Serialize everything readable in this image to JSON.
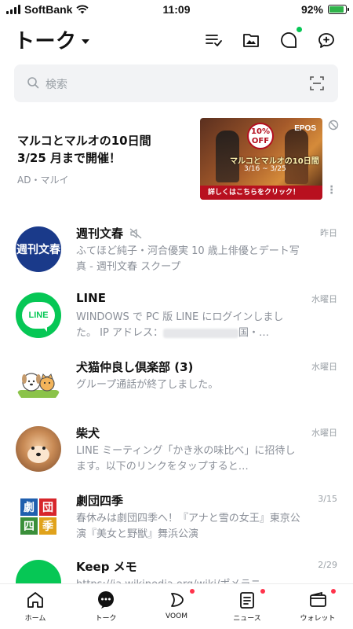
{
  "status_bar": {
    "carrier": "SoftBank",
    "time": "11:09",
    "battery": "92%",
    "battery_level": 0.92
  },
  "header": {
    "title": "トーク"
  },
  "search": {
    "placeholder": "検索"
  },
  "ad": {
    "text_line1": "マルコとマルオの10日間",
    "text_line2": "3/25 月まで開催！",
    "label": "AD・マルイ",
    "banner": {
      "badge": "10% OFF",
      "brand": "EPOS",
      "headline": "マルコとマルオの10日間",
      "date": "3/16 ~ 3/25",
      "cta": "詳しくはこちらをクリック！"
    }
  },
  "chats": [
    {
      "name": "週刊文春",
      "avatar_text": "週刊文春",
      "muted": true,
      "time": "昨日",
      "preview": "ふてほど純子・河合優実 10 歳上俳優とデート写真 - 週刊文春 スクープ"
    },
    {
      "name": "LINE",
      "avatar_text": "LINE",
      "time": "水曜日",
      "preview_line1": "WINDOWS で PC 版 LINE にログインしました。 IP アドレス：",
      "preview_line2": "国・…"
    },
    {
      "name": "犬猫仲良し倶楽部 (3)",
      "time": "水曜日",
      "preview": "グループ通話が終了しました。"
    },
    {
      "name": "柴犬",
      "time": "水曜日",
      "preview": "LINE ミーティング「かき氷の味比べ」に招待します。以下のリンクをタップすると…"
    },
    {
      "name": "劇団四季",
      "avatar_chars": [
        "劇",
        "団",
        "四",
        "季"
      ],
      "time": "3/15",
      "preview": "春休みは劇団四季へ！『アナと雪の女王』東京公演『美女と野獣』舞浜公演"
    },
    {
      "name": "Keep メモ",
      "time": "2/29",
      "preview": "https://ja.wikipedia.org/wiki/ポメラニ…"
    }
  ],
  "bottom_nav": [
    {
      "label": "ホーム",
      "icon": "home-icon",
      "badge": false
    },
    {
      "label": "トーク",
      "icon": "chat-icon",
      "badge": false
    },
    {
      "label": "VOOM",
      "icon": "voom-icon",
      "badge": true
    },
    {
      "label": "ニュース",
      "icon": "news-icon",
      "badge": true
    },
    {
      "label": "ウォレット",
      "icon": "wallet-icon",
      "badge": true
    }
  ],
  "colors": {
    "line_green": "#06c755",
    "badge_red": "#ff334b",
    "muted_text": "#8a8f98"
  }
}
